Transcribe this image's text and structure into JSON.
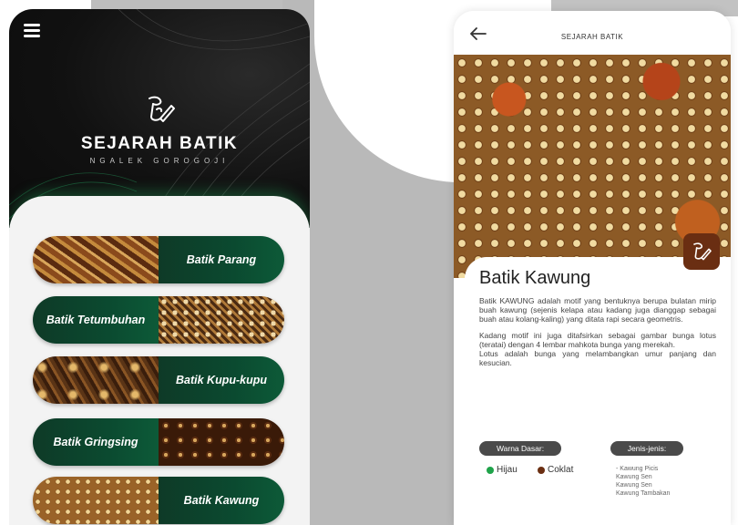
{
  "left_screen": {
    "app_title": "SEJARAH BATIK",
    "app_subtitle": "NGALEK GOROGOJI",
    "batik_list": [
      {
        "label": "Batik Parang"
      },
      {
        "label": "Batik Tetumbuhan"
      },
      {
        "label": "Batik Kupu-kupu"
      },
      {
        "label": "Batik Gringsing"
      },
      {
        "label": "Batik Kawung"
      }
    ]
  },
  "right_screen": {
    "header_title": "SEJARAH BATIK",
    "detail_title": "Batik Kawung",
    "paragraphs": [
      "Batik KAWUNG adalah motif yang bentuknya berupa bulatan mirip buah kawung (sejenis kelapa atau kadang juga dianggap sebagai buah atau kolang-kaling) yang ditata rapi secara geometris.",
      "Kadang motif ini juga ditafsirkan sebagai gambar bunga lotus (teratai) dengan 4 lembar mahkota bunga yang merekah.",
      "Lotus adalah bunga yang melambangkan umur panjang dan kesucian."
    ],
    "base_color_label": "Warna Dasar:",
    "base_colors": [
      {
        "name": "Hijau",
        "color": "#1fa34a"
      },
      {
        "name": "Coklat",
        "color": "#6b2f12"
      }
    ],
    "types_label": "Jenis-jenis:",
    "types": [
      "- Kawung Picis",
      "Kawung Sen",
      "Kawung Sen",
      "Kawung Tambakan"
    ]
  },
  "colors": {
    "brand_green": "#0b4a30",
    "dark_header": "#111111",
    "badge_brown": "#6a2e12"
  }
}
